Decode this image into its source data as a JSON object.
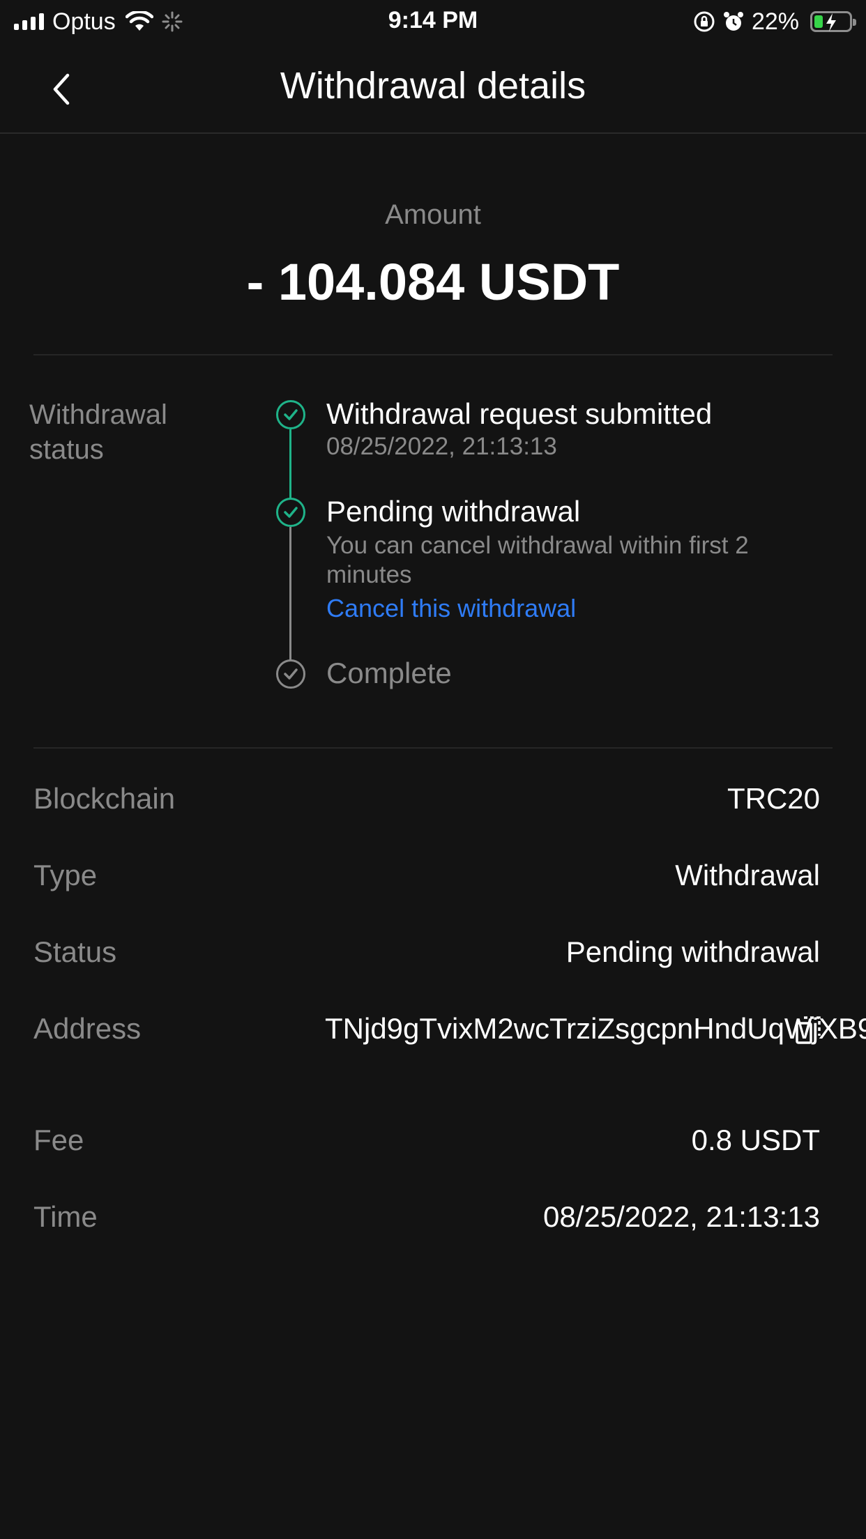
{
  "status_bar": {
    "carrier": "Optus",
    "time": "9:14 PM",
    "battery_percent": "22%"
  },
  "header": {
    "title": "Withdrawal details"
  },
  "amount": {
    "label": "Amount",
    "value": "- 104.084 USDT"
  },
  "withdrawal_status": {
    "label": "Withdrawal status",
    "steps": [
      {
        "title": "Withdrawal request submitted",
        "subtitle": "08/25/2022, 21:13:13",
        "state": "done"
      },
      {
        "title": "Pending withdrawal",
        "subtitle": "You can cancel withdrawal within first 2 minutes",
        "action": "Cancel this withdrawal",
        "state": "done"
      },
      {
        "title": "Complete",
        "state": "pending"
      }
    ]
  },
  "details": {
    "blockchain_label": "Blockchain",
    "blockchain_value": "TRC20",
    "type_label": "Type",
    "type_value": "Withdrawal",
    "status_label": "Status",
    "status_value": "Pending withdrawal",
    "address_label": "Address",
    "address_value": "TNjd9gTvixM2wcTrziZsgcpnHndUqWjXB9",
    "fee_label": "Fee",
    "fee_value": "0.8 USDT",
    "time_label": "Time",
    "time_value": "08/25/2022, 21:13:13"
  },
  "colors": {
    "background": "#131313",
    "success": "#1fb389",
    "link": "#2f7cf6",
    "muted": "#8a8a8a"
  },
  "icons": [
    "signal-icon",
    "wifi-icon",
    "loading-icon",
    "rotation-lock-icon",
    "alarm-icon",
    "battery-icon",
    "back-chevron-icon",
    "check-icon",
    "copy-icon"
  ]
}
